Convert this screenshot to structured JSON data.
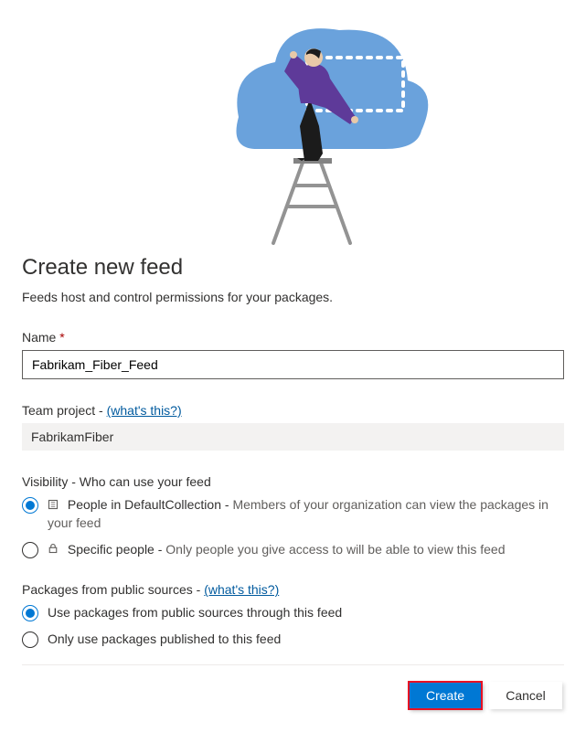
{
  "heading": "Create new feed",
  "subtitle": "Feeds host and control permissions for your packages.",
  "name_field": {
    "label": "Name",
    "required_marker": "*",
    "value": "Fabrikam_Fiber_Feed"
  },
  "team_project": {
    "label": "Team project -",
    "help_text": "(what's this?)",
    "value": "FabrikamFiber"
  },
  "visibility": {
    "label": "Visibility - Who can use your feed",
    "options": [
      {
        "icon": "org-icon",
        "title": "People in DefaultCollection - ",
        "desc": "Members of your organization can view the packages in your feed",
        "checked": true
      },
      {
        "icon": "lock-icon",
        "title": "Specific people - ",
        "desc": "Only people you give access to will be able to view this feed",
        "checked": false
      }
    ]
  },
  "public_sources": {
    "label": "Packages from public sources -",
    "help_text": "(what's this?)",
    "options": [
      {
        "title": "Use packages from public sources through this feed",
        "checked": true
      },
      {
        "title": "Only use packages published to this feed",
        "checked": false
      }
    ]
  },
  "buttons": {
    "primary": "Create",
    "secondary": "Cancel"
  }
}
